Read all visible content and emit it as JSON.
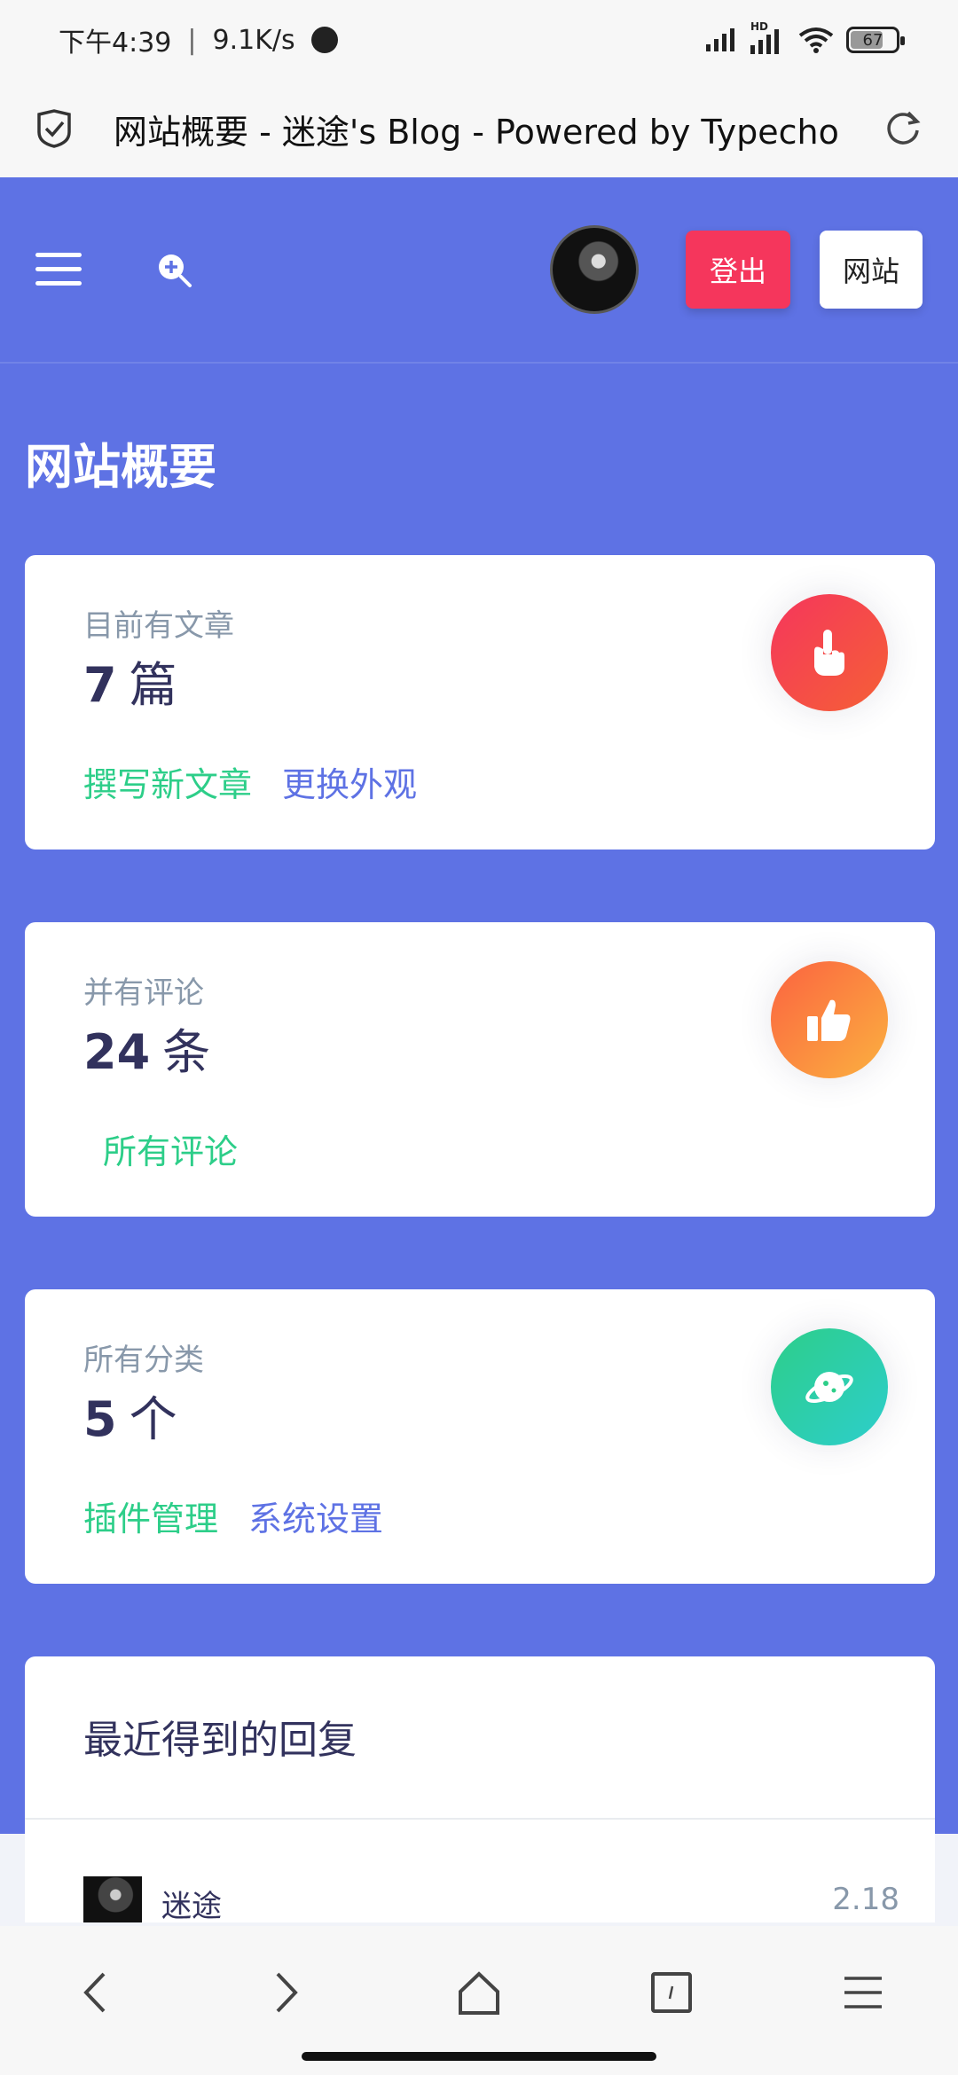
{
  "status_bar": {
    "time": "下午4:39",
    "separator": "|",
    "net_speed": "9.1K/s",
    "network_label": "HD",
    "battery": "67",
    "battery_level": 0.67
  },
  "browser": {
    "page_title": "网站概要 - 迷途's Blog - Powered by Typecho"
  },
  "header": {
    "logout_label": "登出",
    "site_label": "网站"
  },
  "page": {
    "title": "网站概要"
  },
  "cards": [
    {
      "label": "目前有文章",
      "count": "7",
      "unit": "篇",
      "links": [
        "撰写新文章",
        "更换外观"
      ],
      "icon": "pointing-hand-icon",
      "color": "#f5365c"
    },
    {
      "label": "并有评论",
      "count": "24",
      "unit": "条",
      "links": [
        "所有评论"
      ],
      "icon": "thumbs-up-icon",
      "color": "#fb6340"
    },
    {
      "label": "所有分类",
      "count": "5",
      "unit": "个",
      "links": [
        "插件管理",
        "系统设置"
      ],
      "icon": "planet-icon",
      "color": "#2dce89"
    }
  ],
  "recent_replies": {
    "title": "最近得到的回复",
    "items": [
      {
        "name": "迷途",
        "date": "2.18"
      }
    ]
  },
  "colors": {
    "primary": "#5e72e4",
    "danger": "#f5365c",
    "warning": "#fb6340",
    "success": "#2dce89",
    "muted": "#8898aa",
    "heading": "#32325d"
  }
}
